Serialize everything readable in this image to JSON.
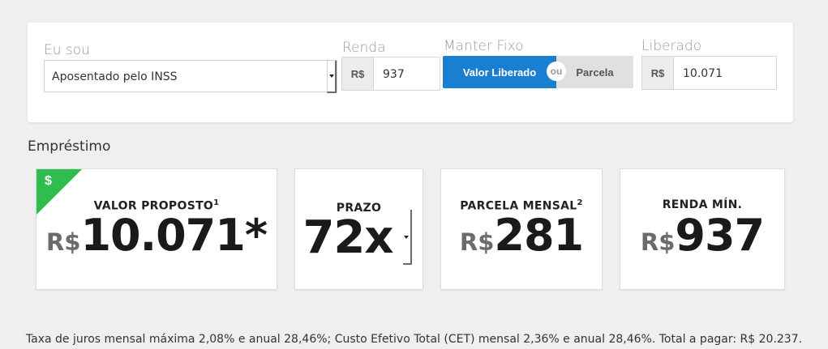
{
  "form": {
    "eu_sou_label": "Eu sou",
    "eu_sou_value": "Aposentado pelo INSS",
    "renda_label": "Renda",
    "renda_currency": "R$",
    "renda_value": "937",
    "manter_fixo_label": "Manter Fixo",
    "toggle_valor_liberado": "Valor Liberado",
    "toggle_or": "ou",
    "toggle_parcela": "Parcela",
    "liberado_label": "Liberado",
    "liberado_currency": "R$",
    "liberado_value": "10.071"
  },
  "section_title": "Empréstimo",
  "cards": {
    "valor_proposto": {
      "badge": "$",
      "label": "VALOR PROPOSTO",
      "sup": "1",
      "currency": "R$",
      "value": "10.071*"
    },
    "prazo": {
      "label": "PRAZO",
      "value": "72x"
    },
    "parcela": {
      "label": "PARCELA MENSAL",
      "sup": "2",
      "currency": "R$",
      "value": "281"
    },
    "renda_min": {
      "label": "RENDA MÍN.",
      "currency": "R$",
      "value": "937"
    }
  },
  "footnote": "Taxa de juros mensal máxima 2,08% e anual 28,46%; Custo Efetivo Total (CET) mensal 2,36% e anual 28,46%. Total a pagar: R$ 20.237.",
  "colors": {
    "accent_blue": "#1a7fd1",
    "badge_green": "#2ebd4e"
  }
}
